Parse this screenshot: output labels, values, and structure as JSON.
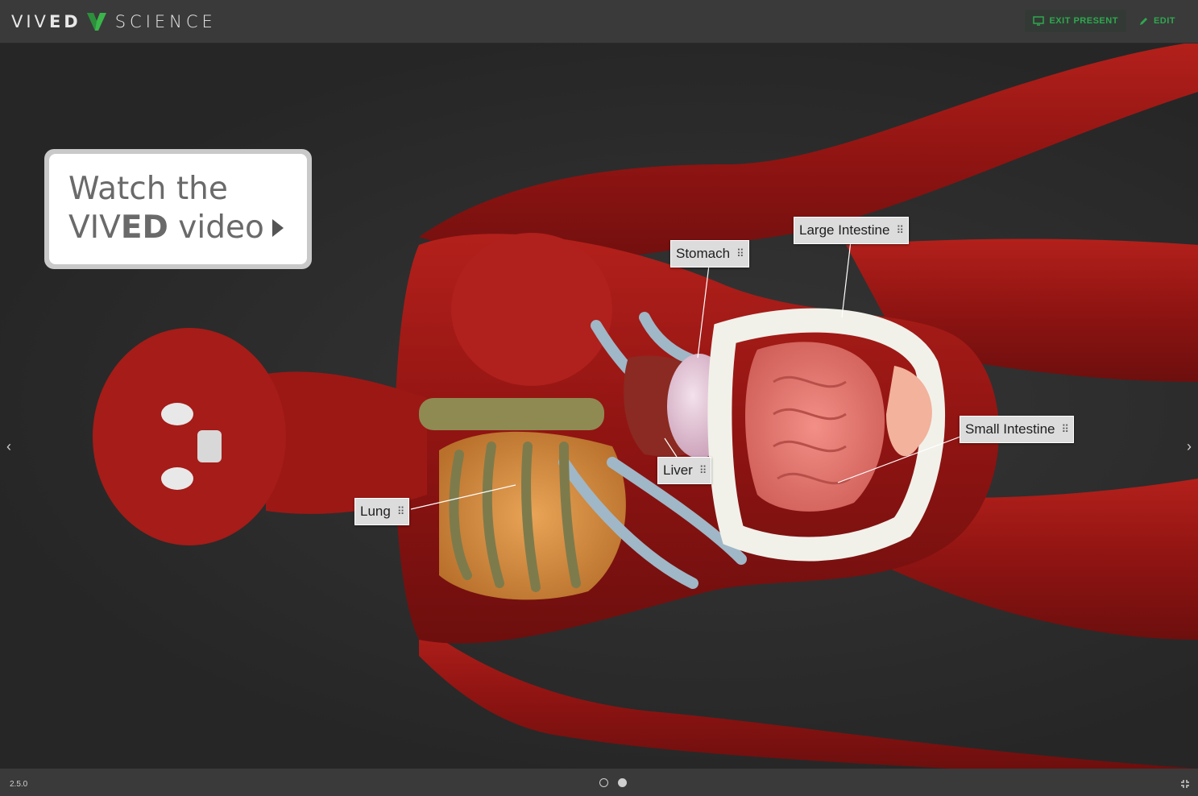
{
  "header": {
    "logo_vived_prefix": "VIV",
    "logo_vived_bold": "ED",
    "logo_science": "SCIENCE",
    "exit_present_label": "EXIT PRESENT",
    "edit_label": "EDIT",
    "accent_color": "#2fa84f"
  },
  "video_card": {
    "line1": "Watch the",
    "line2_prefix": "VIV",
    "line2_bold": "ED",
    "line2_suffix": "video"
  },
  "labels": {
    "large_intestine": "Large Intestine",
    "stomach": "Stomach",
    "small_intestine": "Small Intestine",
    "liver": "Liver",
    "lung": "Lung"
  },
  "footer": {
    "version": "2.5.0",
    "slides": [
      {
        "active": false
      },
      {
        "active": true
      }
    ]
  }
}
